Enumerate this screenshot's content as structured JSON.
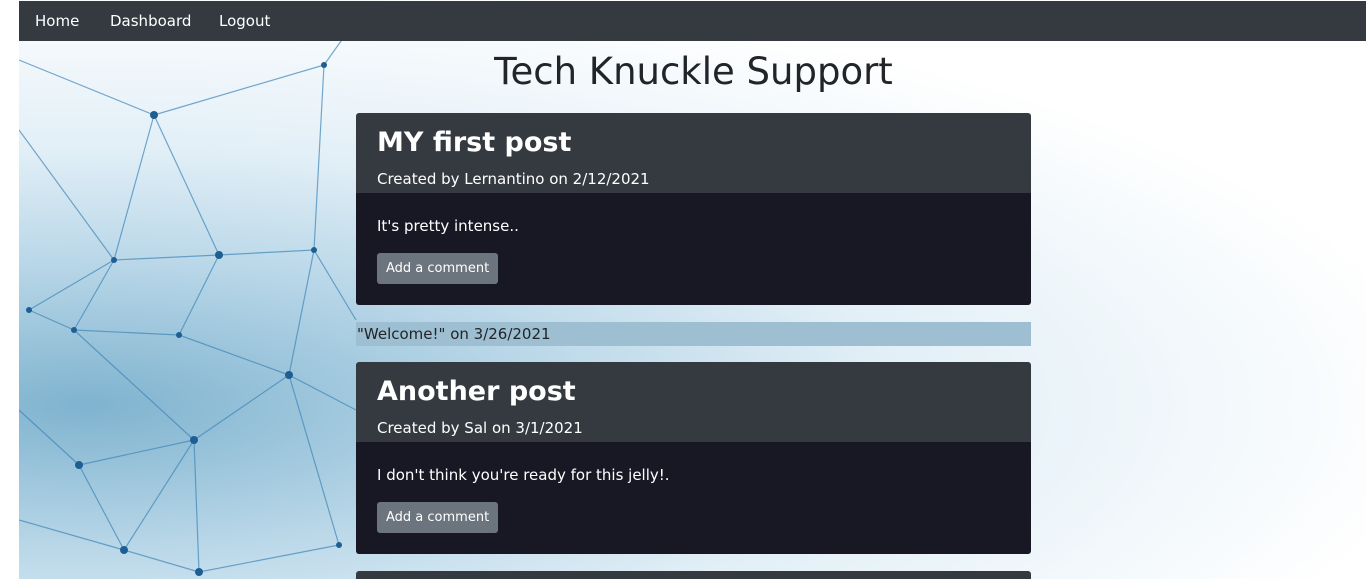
{
  "nav": {
    "items": [
      {
        "label": "Home"
      },
      {
        "label": "Dashboard"
      },
      {
        "label": "Logout"
      }
    ]
  },
  "site": {
    "title": "Tech Knuckle Support"
  },
  "posts": [
    {
      "title": "MY first post",
      "meta": "Created by Lernantino on 2/12/2021",
      "content": "It's pretty intense..",
      "comment_button": "Add a comment"
    },
    {
      "title": "Another post",
      "meta": "Created by Sal on 3/1/2021",
      "content": "I don't think you're ready for this jelly!.",
      "comment_button": "Add a comment"
    }
  ],
  "comments": [
    {
      "text": "\"Welcome!\" on 3/26/2021"
    }
  ],
  "colors": {
    "navbar": "#343a40",
    "card_header": "#343a40",
    "card_body": "#181824",
    "button": "#6c757d",
    "comment_bar": "#9dbfd1"
  }
}
